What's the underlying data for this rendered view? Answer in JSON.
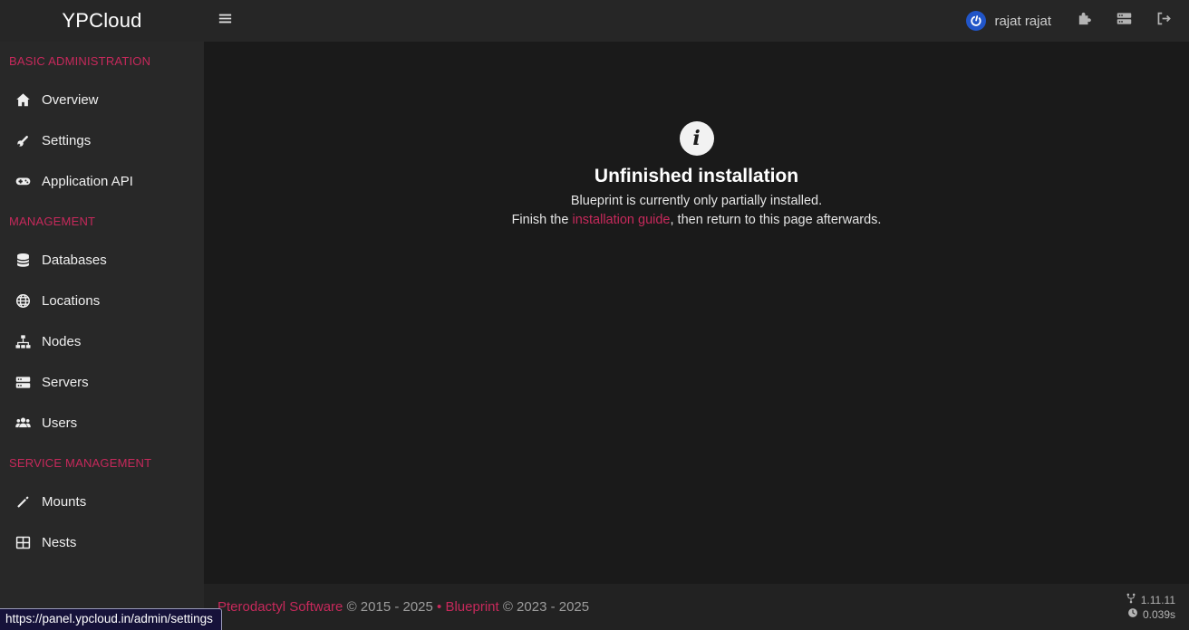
{
  "navbar": {
    "brand": "YPCloud",
    "menu_icon": "bars-icon",
    "user": {
      "name": "rajat rajat",
      "avatar_icon": "power-icon"
    },
    "action_icons": [
      "puzzle-icon",
      "server-icon",
      "logout-icon"
    ]
  },
  "sidebar": {
    "sections": [
      {
        "header": "BASIC ADMINISTRATION",
        "items": [
          {
            "icon": "home-icon",
            "label": "Overview"
          },
          {
            "icon": "wrench-icon",
            "label": "Settings"
          },
          {
            "icon": "gamepad-icon",
            "label": "Application API"
          }
        ]
      },
      {
        "header": "MANAGEMENT",
        "items": [
          {
            "icon": "database-icon",
            "label": "Databases"
          },
          {
            "icon": "globe-icon",
            "label": "Locations"
          },
          {
            "icon": "sitemap-icon",
            "label": "Nodes"
          },
          {
            "icon": "server-icon",
            "label": "Servers"
          },
          {
            "icon": "users-icon",
            "label": "Users"
          }
        ]
      },
      {
        "header": "SERVICE MANAGEMENT",
        "items": [
          {
            "icon": "magic-wand-icon",
            "label": "Mounts"
          },
          {
            "icon": "grid-icon",
            "label": "Nests"
          }
        ]
      }
    ]
  },
  "main": {
    "info_glyph": "i",
    "title": "Unfinished installation",
    "line1": "Blueprint is currently only partially installed.",
    "line2_prefix": "Finish the ",
    "line2_link": "installation guide",
    "line2_suffix": ", then return to this page afterwards."
  },
  "footer": {
    "link1": "Pterodactyl Software",
    "text1": " © 2015 - 2025 ",
    "bullet": "• ",
    "link2": "Blueprint",
    "text2": " © 2023 - 2025",
    "version": "1.11.11",
    "render_time": "0.039s"
  },
  "status_bar": {
    "url": "https://panel.ypcloud.in/admin/settings"
  },
  "colors": {
    "accent": "#c6295b",
    "avatar_blue": "#2155c8"
  }
}
